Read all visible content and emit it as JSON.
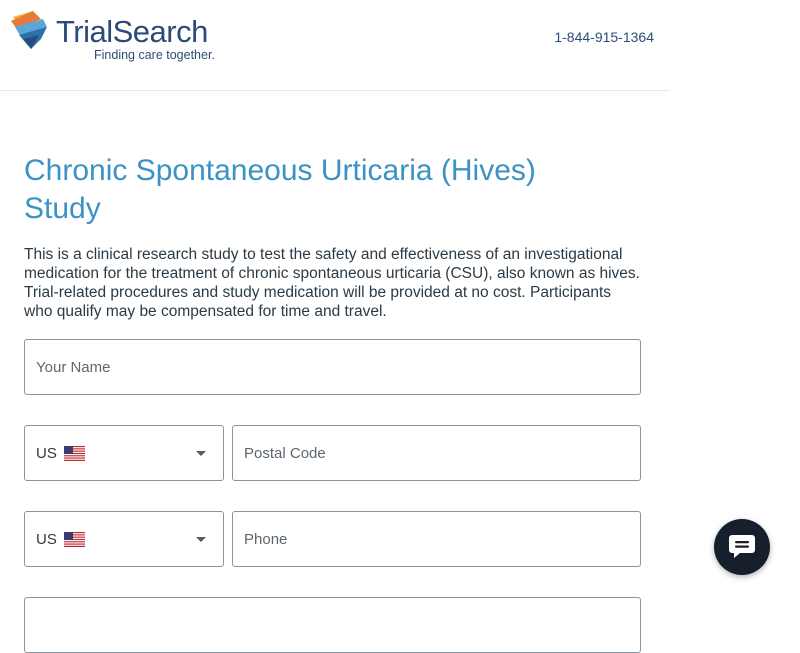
{
  "header": {
    "logo_name": "TrialSearch",
    "logo_tagline": "Finding care together.",
    "phone": "1-844-915-1364"
  },
  "main": {
    "title": "Chronic Spontaneous Urticaria (Hives) Study",
    "description": "This is a clinical research study to test the safety and effectiveness of an investigational medication for the treatment of chronic spontaneous urticaria (CSU), also known as hives. Trial-related procedures and study medication will be provided at no cost. Participants who qualify may be compensated for time and travel."
  },
  "form": {
    "name_placeholder": "Your Name",
    "postal_country": {
      "code": "US",
      "flag_icon": "us-flag-icon"
    },
    "postal_placeholder": "Postal Code",
    "phone_country": {
      "code": "US",
      "flag_icon": "us-flag-icon"
    },
    "phone_placeholder": "Phone"
  },
  "chat": {
    "icon": "chat-bubble-icon"
  },
  "colors": {
    "title_blue": "#3a93c4",
    "brand_navy": "#2d4b7a",
    "chat_bg": "#16202d"
  }
}
